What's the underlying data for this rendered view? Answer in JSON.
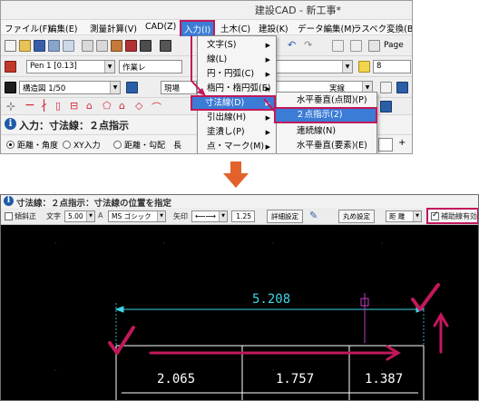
{
  "top": {
    "title": "建設CAD - 新工事*",
    "menubar": [
      "ファイル(F)",
      "編集(E)",
      "測量計算(V)",
      "CAD(Z)",
      "入力(I)",
      "土木(C)",
      "建設(K)",
      "データ編集(M)",
      "ラスベク変換(B)"
    ],
    "toolbar1": {
      "page_label": "Page"
    },
    "toolbar2": {
      "pen_combo": "Pen 1 [0.13]",
      "layer_combo": "作業レ",
      "size_combo": "8"
    },
    "toolbar3": {
      "scale_combo": "構造図 1/50",
      "site_combo": "現場",
      "line_combo": "実線"
    },
    "status_message": "入力：寸法線：２点指示",
    "options": {
      "opt1": "距離・角度",
      "opt2": "XY入力",
      "opt3": "距離・勾配",
      "opt4": "長"
    },
    "menu_input": {
      "items": [
        "文字(S)",
        "線(L)",
        "円・円弧(C)",
        "楕円・楕円弧(E)",
        "寸法線(D)",
        "引出線(H)",
        "塗潰し(P)",
        "点・マーク(M)"
      ],
      "selected_index": 4
    },
    "menu_dim": {
      "items": [
        "水平垂直(点間)(P)",
        "２点指示(2)",
        "連続線(N)",
        "水平垂直(要素)(E)"
      ],
      "selected_index": 1
    },
    "colors": {
      "menu_highlight": "#3b7cd6",
      "annotation_red": "#c2185b"
    }
  },
  "bottom": {
    "status_message": "寸法線：２点指示：寸法線の位置を指定",
    "toolbar": {
      "paralel_label": "傾斜正",
      "char_label": "文字",
      "char_size": "5.00",
      "font": "MS ゴシック",
      "arrow_label": "矢印",
      "arrow_size": "1.25",
      "detail_button": "詳細設定",
      "round_button": "丸め設定",
      "distance_combo": "距 離",
      "aux_checkbox": "補助線有効"
    },
    "dimension_total": "5.208",
    "dimension_segments": [
      "2.065",
      "1.757",
      "1.387"
    ],
    "colors": {
      "cad_background": "#000000",
      "dimension_cyan": "#3fd5e8",
      "annotation_red": "#c2185b",
      "accent_orange": "#e3622b"
    }
  }
}
